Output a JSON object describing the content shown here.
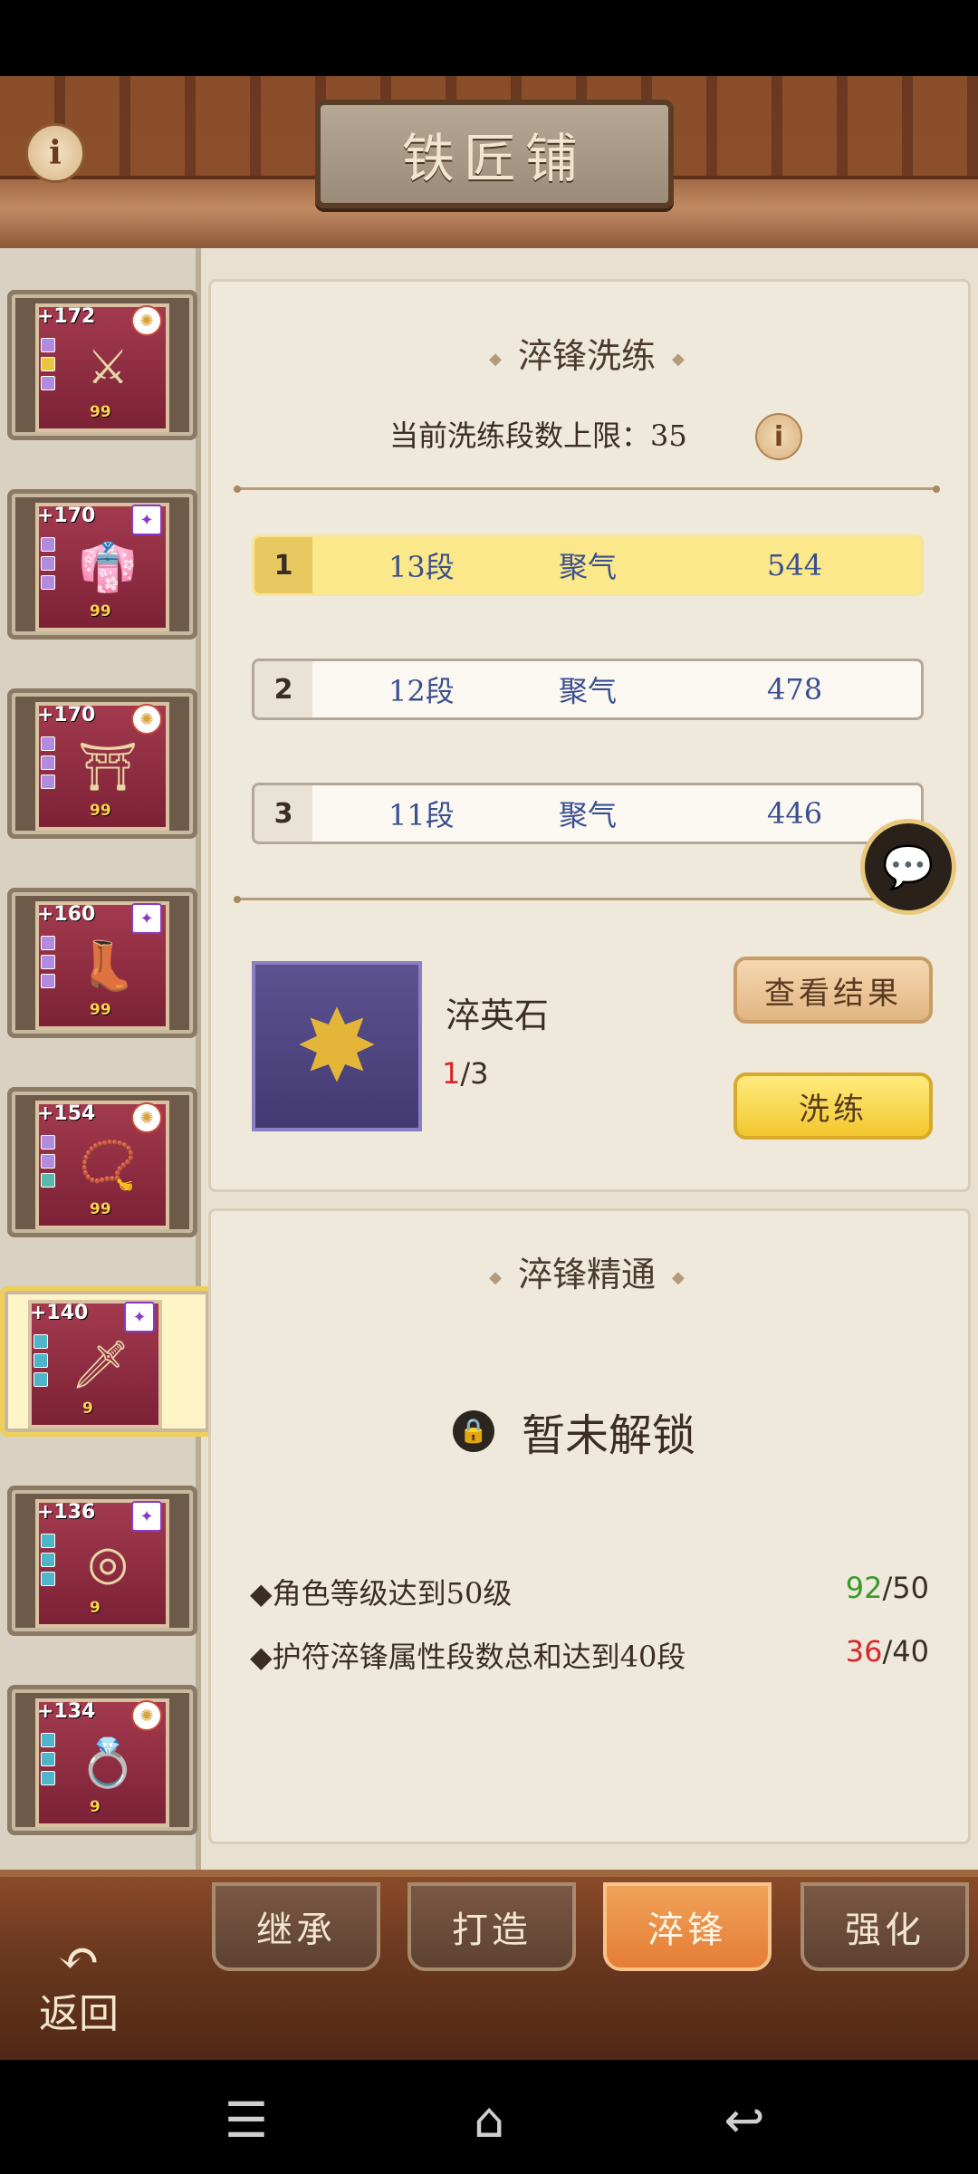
{
  "header": {
    "title": "铁匠铺",
    "info_icon": "i"
  },
  "equipment": [
    {
      "level": "+172",
      "count": "99",
      "badge": "✺",
      "badge_type": "circle",
      "item_icon": "sword"
    },
    {
      "level": "+170",
      "count": "99",
      "badge": "✦",
      "badge_type": "diamond",
      "item_icon": "robe"
    },
    {
      "level": "+170",
      "count": "99",
      "badge": "✺",
      "badge_type": "circle",
      "item_icon": "belt"
    },
    {
      "level": "+160",
      "count": "99",
      "badge": "✦",
      "badge_type": "diamond",
      "item_icon": "boots"
    },
    {
      "level": "+154",
      "count": "99",
      "badge": "✺",
      "badge_type": "circle",
      "item_icon": "necklace"
    },
    {
      "level": "+140",
      "count": "9",
      "badge": "✦",
      "badge_type": "diamond",
      "item_icon": "talisman"
    },
    {
      "level": "+136",
      "count": "9",
      "badge": "✦",
      "badge_type": "diamond",
      "item_icon": "bracer"
    },
    {
      "level": "+134",
      "count": "9",
      "badge": "✺",
      "badge_type": "circle",
      "item_icon": "ring"
    }
  ],
  "refine": {
    "title": "淬锋洗练",
    "limit_text": "当前洗练段数上限：35",
    "rows": [
      {
        "index": "1",
        "level": "13段",
        "attr": "聚气",
        "value": "544"
      },
      {
        "index": "2",
        "level": "12段",
        "attr": "聚气",
        "value": "478"
      },
      {
        "index": "3",
        "level": "11段",
        "attr": "聚气",
        "value": "446"
      }
    ],
    "material": {
      "name": "淬英石",
      "have": "1",
      "need": "/3"
    },
    "view_button": "查看结果",
    "refine_button": "洗练"
  },
  "mastery": {
    "title": "淬锋精通",
    "locked_text": "暂未解锁",
    "requirements": [
      {
        "text": "◆角色等级达到50级",
        "current": "92",
        "total": "/50",
        "met": true
      },
      {
        "text": "◆护符淬锋属性段数总和达到40段",
        "current": "36",
        "total": "/40",
        "met": false
      }
    ]
  },
  "tabs": [
    "继承",
    "打造",
    "淬锋",
    "强化"
  ],
  "active_tab": "淬锋",
  "back_label": "返回",
  "colors": {
    "accent_orange": "#e57d36",
    "selected_row": "#fbe88a",
    "met": "#3a9a2a",
    "unmet": "#d8262b"
  }
}
